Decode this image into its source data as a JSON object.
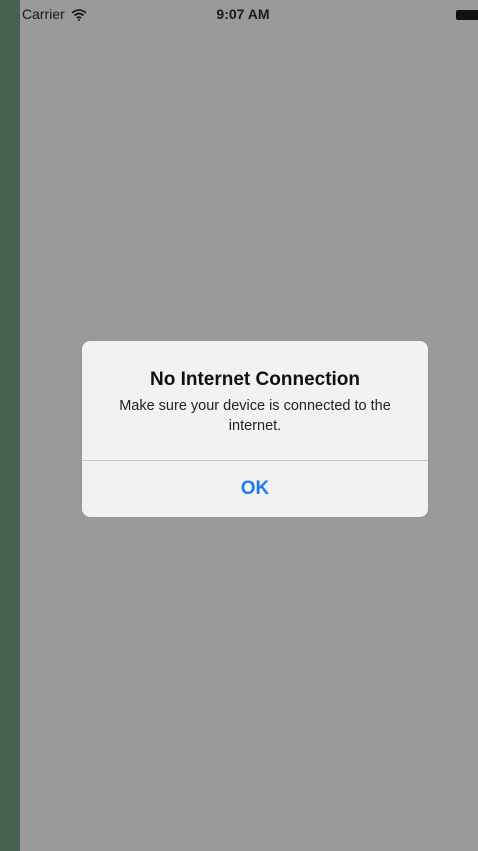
{
  "status_bar": {
    "carrier": "Carrier",
    "time": "9:07 AM"
  },
  "alert": {
    "title": "No Internet Connection",
    "message": "Make sure your device is connected to the internet.",
    "button_label": "OK"
  },
  "colors": {
    "accent": "#1b7cf2",
    "overlay": "#9a9a9a",
    "frame": "#466150",
    "alert_background": "#f2f2f2"
  },
  "icons": [
    "wifi-icon",
    "battery-icon"
  ]
}
